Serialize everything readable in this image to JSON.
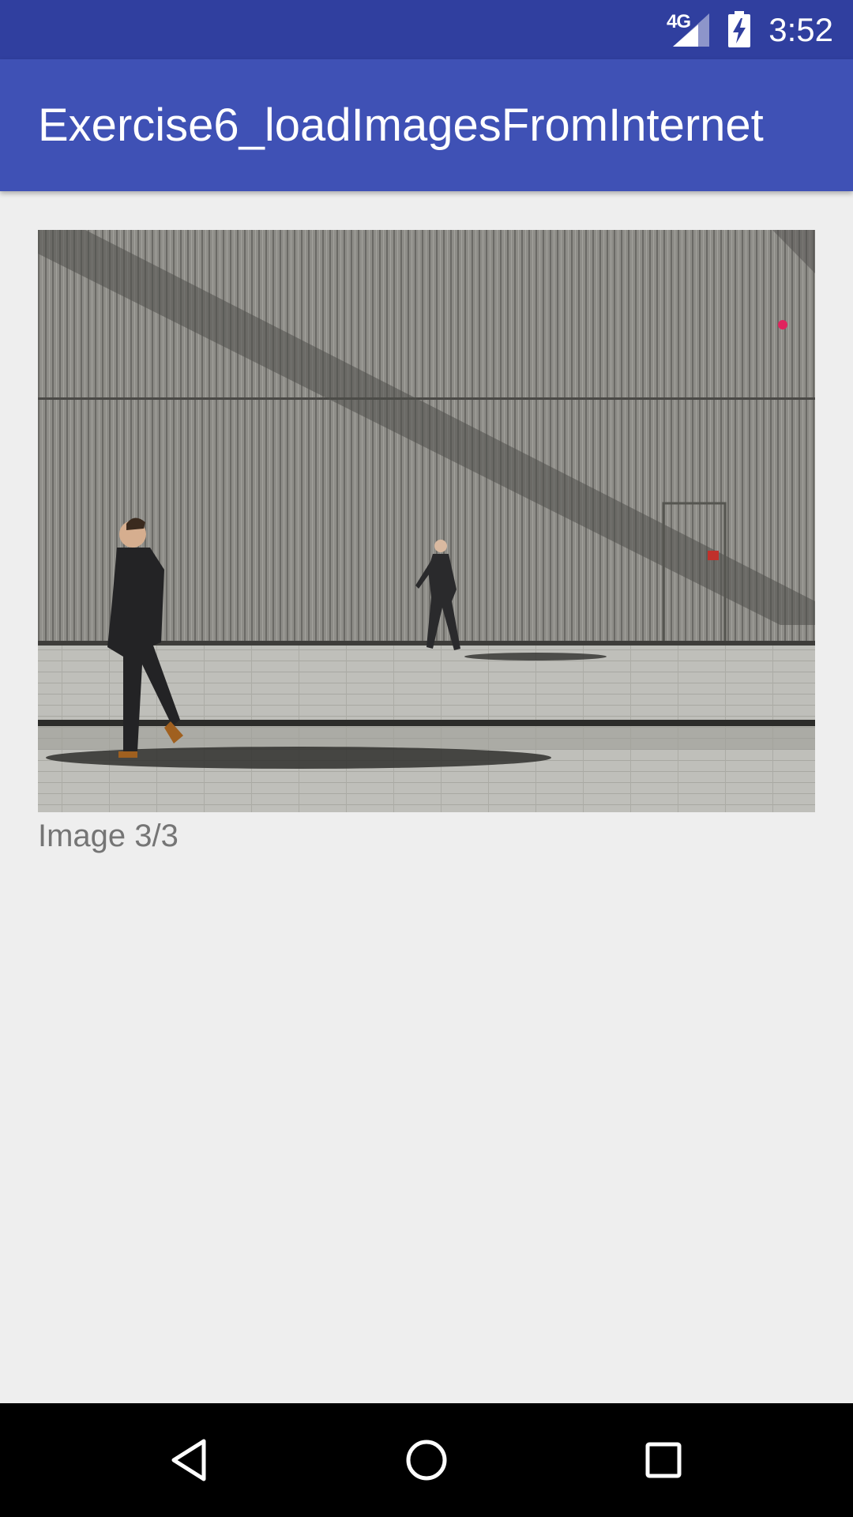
{
  "status_bar": {
    "network_label": "4G",
    "time": "3:52",
    "icons": [
      "signal-icon",
      "battery-charging-icon"
    ]
  },
  "app_bar": {
    "title": "Exercise6_loadImagesFromInternet",
    "color": "#3f51b5"
  },
  "content": {
    "image_description_icon": "photo",
    "caption": "Image 3/3"
  },
  "nav_bar": {
    "icons": [
      "back-icon",
      "home-icon",
      "recents-icon"
    ]
  },
  "colors": {
    "status_bar": "#303f9f",
    "app_bar": "#3f51b5",
    "background": "#eeeeee",
    "caption_text": "#757575"
  }
}
